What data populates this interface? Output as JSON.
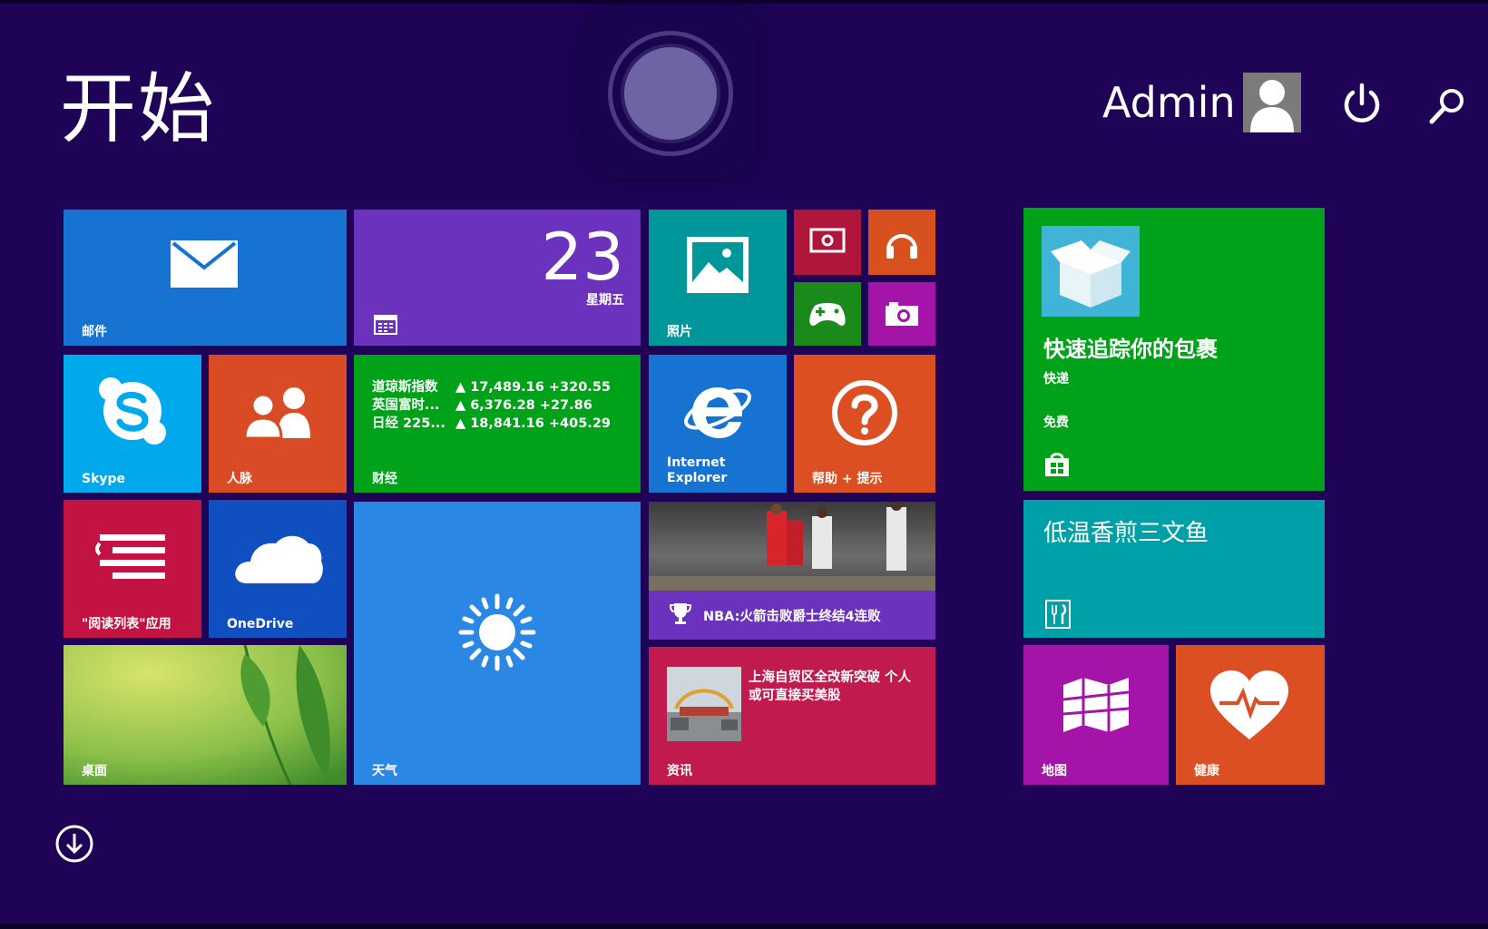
{
  "start": {
    "title": "开始"
  },
  "user": {
    "name": "Admin"
  },
  "tiles": {
    "mail": {
      "label": "邮件"
    },
    "calendar": {
      "day": "23",
      "weekday": "星期五"
    },
    "photos": {
      "label": "照片"
    },
    "skype": {
      "label": "Skype"
    },
    "people": {
      "label": "人脉"
    },
    "finance": {
      "label": "财经",
      "rows": [
        {
          "name": "道琼斯指数",
          "value": "▲ 17,489.16 +320.55"
        },
        {
          "name": "英国富时...",
          "value": "▲ 6,376.28 +27.86"
        },
        {
          "name": "日经 225...",
          "value": "▲ 18,841.16 +405.29"
        }
      ]
    },
    "ie": {
      "label_line1": "Internet",
      "label_line2": "Explorer"
    },
    "help": {
      "label": "帮助 + 提示"
    },
    "reading": {
      "label": "\"阅读列表\"应用"
    },
    "onedrive": {
      "label": "OneDrive"
    },
    "weather": {
      "label": "天气"
    },
    "sports": {
      "caption": "NBA:火箭击败爵士终结4连败"
    },
    "desktop": {
      "label": "桌面"
    },
    "news": {
      "text": "上海自贸区全改新突破 个人或可直接买美股",
      "label": "资讯"
    },
    "store": {
      "headline": "快速追踪你的包裹",
      "app": "快递",
      "price": "免费"
    },
    "food": {
      "headline": "低温香煎三文鱼"
    },
    "maps": {
      "label": "地图"
    },
    "health": {
      "label": "健康"
    }
  },
  "colors": {
    "background": "#1e0357",
    "mail": "#1673d1",
    "calendar": "#6b32bd",
    "finance": "#00a21a",
    "store": "#00a21a",
    "weather": "#2b87e4",
    "news": "#c01a4f"
  }
}
